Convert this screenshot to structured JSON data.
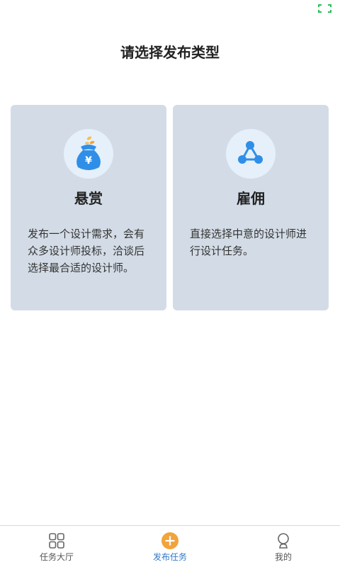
{
  "status_bar": {
    "icon": "fullscreen-icon",
    "icon_color": "#2ebd5a"
  },
  "page": {
    "title": "请选择发布类型"
  },
  "cards": [
    {
      "icon": "money-bag-icon",
      "icon_symbol": "¥",
      "title": "悬赏",
      "description": "发布一个设计需求，会有众多设计师投标，洽谈后选择最合适的设计师。"
    },
    {
      "icon": "share-network-icon",
      "title": "雇佣",
      "description": "直接选择中意的设计师进行设计任务。"
    }
  ],
  "bottom_nav": {
    "items": [
      {
        "label": "任务大厅",
        "icon": "grid-icon",
        "active": false
      },
      {
        "label": "发布任务",
        "icon": "plus-circle-icon",
        "active": true
      },
      {
        "label": "我的",
        "icon": "person-icon",
        "active": false
      }
    ]
  },
  "colors": {
    "card_background": "#d3dce6",
    "icon_blue": "#2f8fe8",
    "accent_orange": "#f2a33a",
    "active_nav": "#2f79c9"
  }
}
